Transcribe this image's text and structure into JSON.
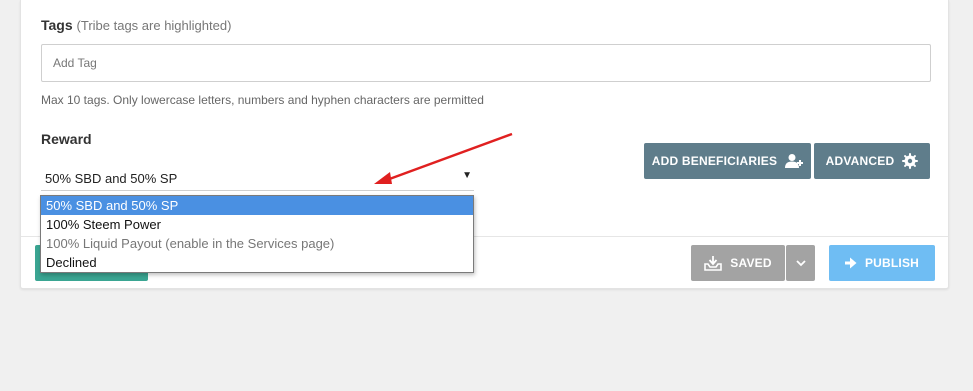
{
  "tags": {
    "label": "Tags",
    "hint": "(Tribe tags are highlighted)",
    "placeholder": "Add Tag",
    "rules": "Max 10 tags. Only lowercase letters, numbers and hyphen characters are permitted"
  },
  "reward": {
    "label": "Reward",
    "selected": "50% SBD and 50% SP",
    "options": [
      {
        "label": "50% SBD and 50% SP",
        "state": "selected"
      },
      {
        "label": "100% Steem Power",
        "state": "normal"
      },
      {
        "label": "100% Liquid Payout (enable in the Services page)",
        "state": "disabled"
      },
      {
        "label": "Declined",
        "state": "normal"
      }
    ]
  },
  "buttons": {
    "beneficiaries": "ADD BENEFICIARIES",
    "advanced": "ADVANCED",
    "saved": "SAVED",
    "publish": "PUBLISH"
  },
  "icons": {
    "beneficiaries": "user-add-icon",
    "advanced": "gear-icon",
    "saved": "inbox-download-icon",
    "saved_toggle": "chevron-down-icon",
    "publish": "arrow-right-icon"
  },
  "colors": {
    "slate_button": "#5f7d8b",
    "saved_button": "#a3a3a3",
    "publish_button": "#6fbdf3",
    "selected_option": "#4a90e2",
    "teal_button": "#3aa592",
    "annotation_arrow": "#e02020"
  }
}
